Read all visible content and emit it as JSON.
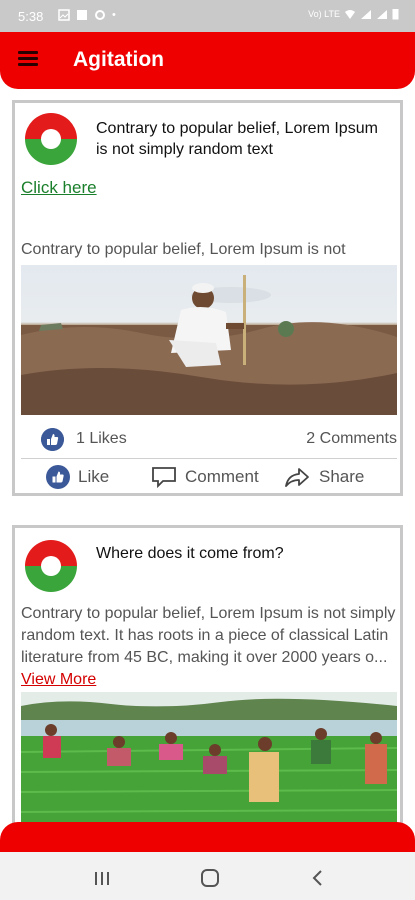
{
  "status_bar": {
    "time": "5:38",
    "network": "Vo) LTE"
  },
  "app_bar": {
    "title": "Agitation",
    "menu_icon": "hamburger-menu-icon"
  },
  "posts": [
    {
      "title": "Contrary to popular belief, Lorem Ipsum is not simply random text",
      "link_text": "Click here",
      "body": "Contrary to popular belief, Lorem Ipsum is not",
      "likes": "1 Likes",
      "comments": "2 Comments",
      "actions": {
        "like": "Like",
        "comment": "Comment",
        "share": "Share"
      }
    },
    {
      "title": "Where does it come from?",
      "body": "Contrary to popular belief, Lorem Ipsum is not simply random text. It has roots in a piece of classical Latin literature from 45 BC, making it over 2000 years o...",
      "view_more": "View More"
    }
  ],
  "colors": {
    "primary": "#ee0000",
    "link_green": "#1a7f2b",
    "facebook_blue": "#3b5998",
    "view_more_red": "#d40000"
  }
}
